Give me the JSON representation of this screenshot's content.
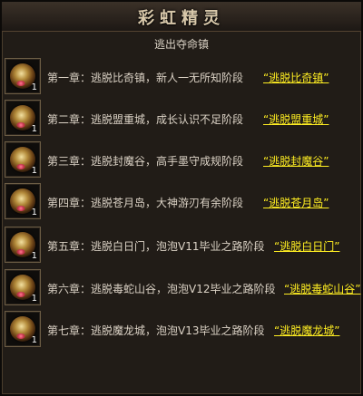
{
  "window": {
    "title": "彩虹精灵"
  },
  "subtitle": "逃出夺命镇",
  "chapters": [
    {
      "text": "第一章：逃脱比奇镇，新人一无所知阶段",
      "link": "“逃脱比奇镇”",
      "count": "1"
    },
    {
      "text": "第二章：逃脱盟重城，成长认识不足阶段",
      "link": "“逃脱盟重城”",
      "count": "1"
    },
    {
      "text": "第三章：逃脱封魔谷，高手墨守成规阶段",
      "link": "“逃脱封魔谷”",
      "count": "1"
    },
    {
      "text": "第四章：逃脱苍月岛，大神游刃有余阶段",
      "link": "“逃脱苍月岛”",
      "count": "1"
    },
    {
      "text": "第五章：逃脱白日门，泡泡V11毕业之路阶段",
      "link": "“逃脱白日门”",
      "count": "1"
    },
    {
      "text": "第六章：逃脱毒蛇山谷，泡泡V12毕业之路阶段",
      "link": "“逃脱毒蛇山谷”",
      "count": "1"
    },
    {
      "text": "第七章：逃脱魔龙城，泡泡V13毕业之路阶段",
      "link": "“逃脱魔龙城”",
      "count": "1"
    }
  ],
  "colors": {
    "link": "#ffee22",
    "text": "#dcd3c6",
    "panel": "#211c17"
  },
  "icons": {
    "item": "golden-orb-icon"
  }
}
